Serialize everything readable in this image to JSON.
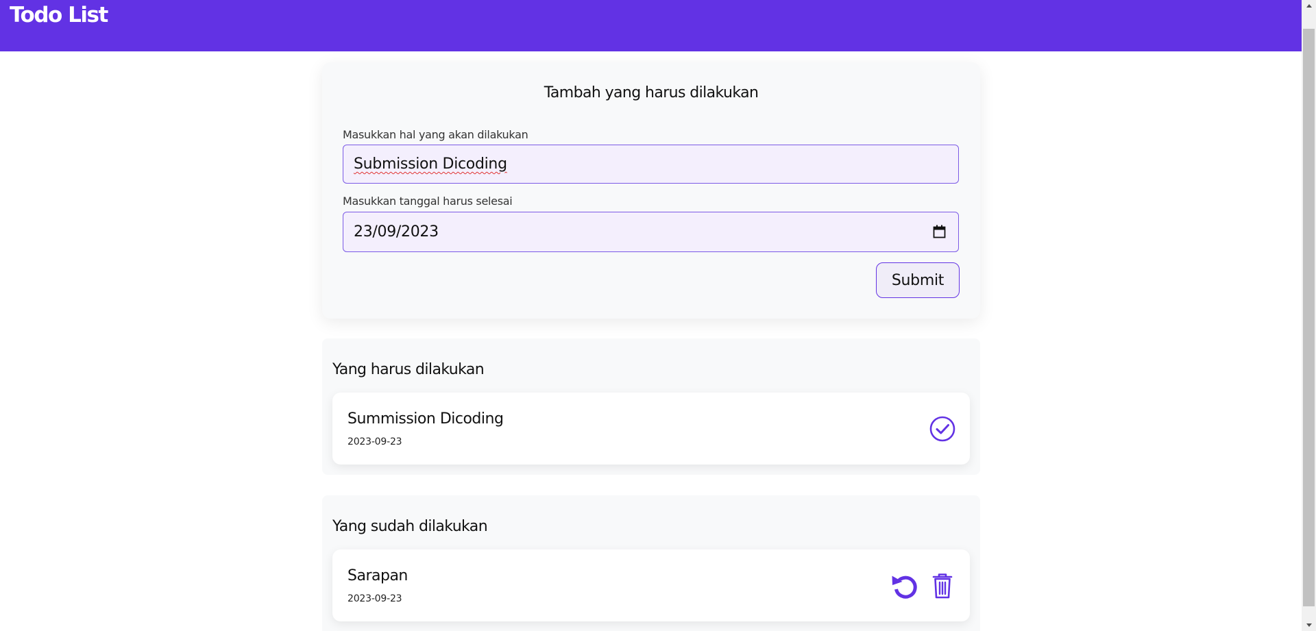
{
  "app": {
    "title": "Todo List"
  },
  "form": {
    "title": "Tambah yang harus dilakukan",
    "task_label": "Masukkan hal yang akan dilakukan",
    "task_value": "Submission Dicoding",
    "date_label": "Masukkan tanggal harus selesai",
    "date_value": "23/09/2023",
    "submit_label": "Submit"
  },
  "incomplete": {
    "title": "Yang harus dilakukan",
    "items": [
      {
        "title": "Summission Dicoding",
        "date": "2023-09-23",
        "action_icon": "check-circle-icon"
      }
    ]
  },
  "complete": {
    "title": "Yang sudah dilakukan",
    "items": [
      {
        "title": "Sarapan",
        "date": "2023-09-23",
        "action_icons": [
          "undo-icon",
          "trash-icon"
        ]
      }
    ]
  },
  "colors": {
    "accent": "#6232e4",
    "card_bg": "#f8f9fa",
    "input_bg": "#f4effd"
  }
}
